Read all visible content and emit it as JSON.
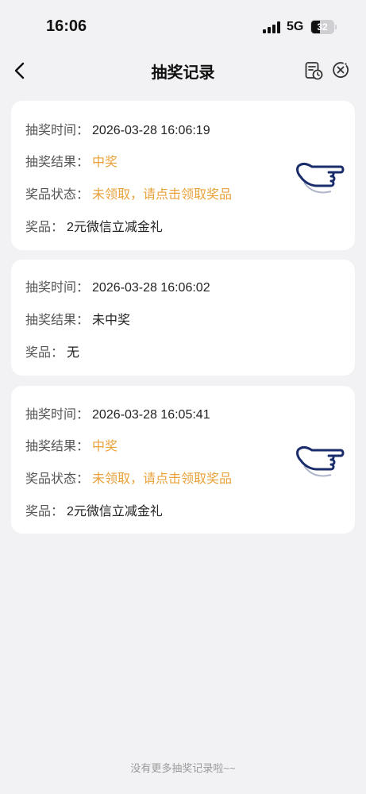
{
  "status_bar": {
    "time": "16:06",
    "network": "5G",
    "battery": "32"
  },
  "nav": {
    "title": "抽奖记录"
  },
  "records": [
    {
      "time_label": "抽奖时间：",
      "time": "2026-03-28 16:06:19",
      "result_label": "抽奖结果：",
      "result": "中奖",
      "status_label": "奖品状态：",
      "status": "未领取，请点击领取奖品",
      "prize_label": "奖品：",
      "prize": "2元微信立减金礼"
    },
    {
      "time_label": "抽奖时间：",
      "time": "2026-03-28 16:06:02",
      "result_label": "抽奖结果：",
      "result": "未中奖",
      "prize_label": "奖品：",
      "prize": "无"
    },
    {
      "time_label": "抽奖时间：",
      "time": "2026-03-28 16:05:41",
      "result_label": "抽奖结果：",
      "result": "中奖",
      "status_label": "奖品状态：",
      "status": "未领取，请点击领取奖品",
      "prize_label": "奖品：",
      "prize": "2元微信立减金礼"
    }
  ],
  "footer": {
    "end_text": "没有更多抽奖记录啦~~"
  },
  "colors": {
    "background": "#f2f2f4",
    "card": "#ffffff",
    "accent": "#e9a13a"
  },
  "icons": [
    "back-icon",
    "doc-clock-icon",
    "close-circle-icon",
    "pointing-hand-icon"
  ]
}
